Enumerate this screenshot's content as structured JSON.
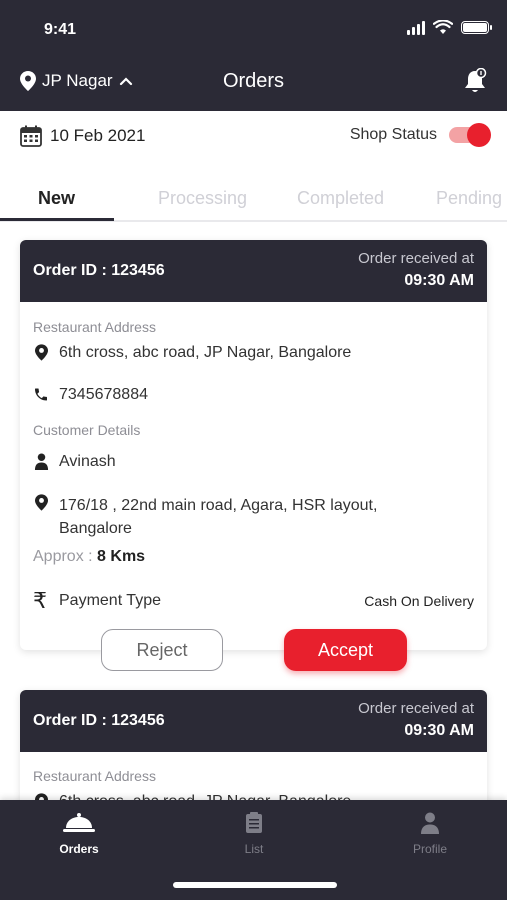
{
  "status_bar": {
    "time": "9:41"
  },
  "header": {
    "location": "JP Nagar",
    "title": "Orders"
  },
  "date_bar": {
    "date": "10 Feb 2021",
    "shop_status_label": "Shop Status",
    "shop_status_on": true
  },
  "tabs": [
    {
      "label": "New",
      "active": true
    },
    {
      "label": "Processing",
      "active": false
    },
    {
      "label": "Completed",
      "active": false
    },
    {
      "label": "Pending",
      "active": false
    }
  ],
  "orders": [
    {
      "order_id": "Order ID : 123456",
      "received_label": "Order received at",
      "received_time": "09:30 AM",
      "restaurant_label": "Restaurant Address",
      "restaurant_address": "6th cross, abc road, JP Nagar, Bangalore",
      "phone": "7345678884",
      "customer_label": "Customer Details",
      "customer_name": "Avinash",
      "customer_address_line1": "176/18 , 22nd main road, Agara, HSR layout,",
      "customer_address_line2": "Bangalore",
      "approx_label": "Approx :",
      "approx_value": "8 Kms",
      "payment_label": "Payment Type",
      "payment_value": "Cash On Delivery",
      "reject_label": "Reject",
      "accept_label": "Accept"
    },
    {
      "order_id": "Order ID : 123456",
      "received_label": "Order received at",
      "received_time": "09:30 AM",
      "restaurant_label": "Restaurant Address",
      "restaurant_address": "6th cross, abc road, JP Nagar, Bangalore"
    }
  ],
  "bottom_nav": [
    {
      "label": "Orders",
      "icon": "cloche-icon",
      "active": true
    },
    {
      "label": "List",
      "icon": "list-icon",
      "active": false
    },
    {
      "label": "Profile",
      "icon": "user-icon",
      "active": false
    }
  ],
  "colors": {
    "dark": "#2b2a36",
    "accent": "#e8202d",
    "muted": "#8e8e95"
  }
}
